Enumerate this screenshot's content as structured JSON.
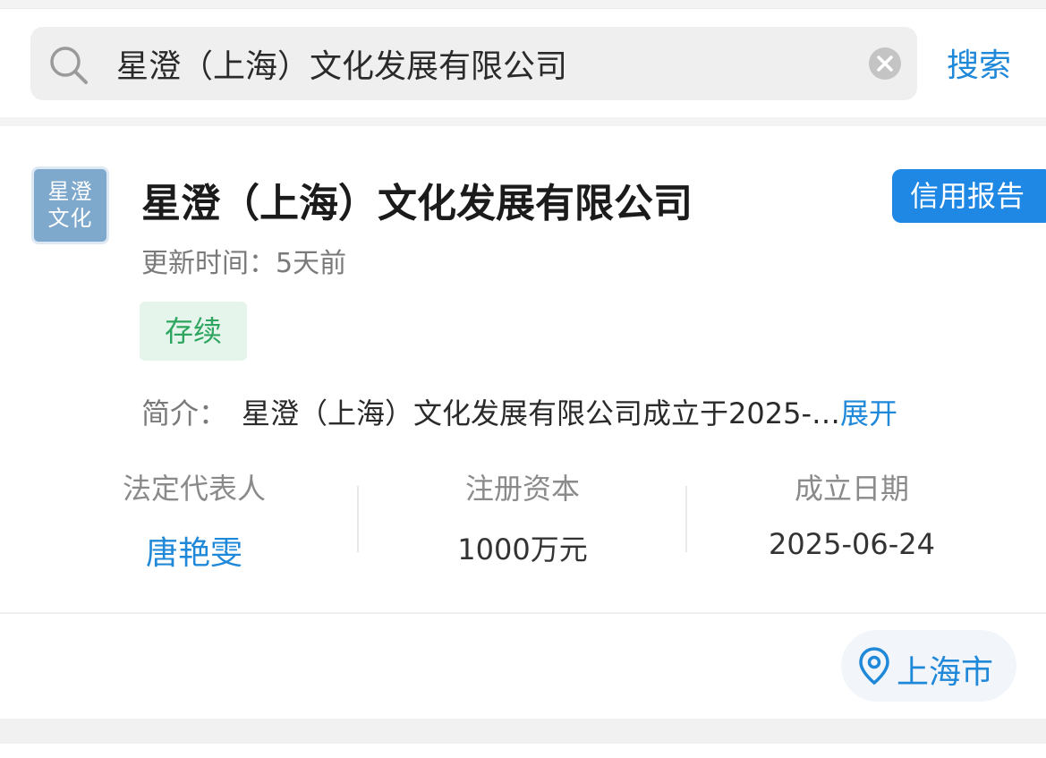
{
  "search": {
    "query": "星澄（上海）文化发展有限公司",
    "button_label": "搜索"
  },
  "company": {
    "logo_line1": "星澄",
    "logo_line2": "文化",
    "name": "星澄（上海）文化发展有限公司",
    "credit_report_label": "信用报告",
    "update_time": "更新时间：5天前",
    "status": "存续",
    "intro_label": "简介：",
    "intro_text": "星澄（上海）文化发展有限公司成立于2025-…",
    "expand_label": "展开",
    "stats": {
      "legal_rep_label": "法定代表人",
      "legal_rep_value": "唐艳雯",
      "capital_label": "注册资本",
      "capital_value": "1000万元",
      "founded_label": "成立日期",
      "founded_value": "2025-06-24"
    },
    "region": "上海市"
  },
  "colors": {
    "accent": "#1f88d8",
    "status_green": "#2ea660",
    "status_bg": "#e5f5ec",
    "logo_bg": "#7ea8cc"
  },
  "icons": {
    "search": "search-icon",
    "clear": "clear-icon",
    "location": "location-icon"
  }
}
